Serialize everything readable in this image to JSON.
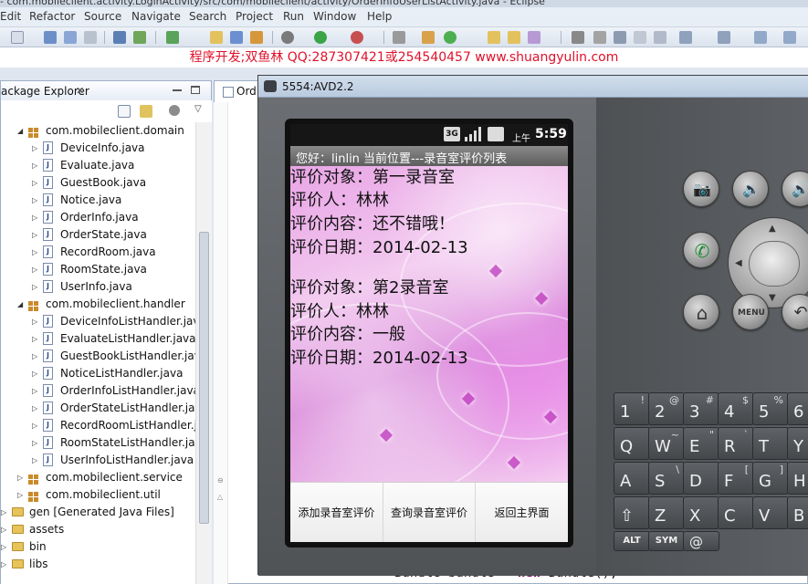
{
  "window": {
    "title": "- com.mobileclient.activity.LoginActivity/src/com/mobileclient/activity/OrderInfoUserListActivity.java - Eclipse"
  },
  "menu": [
    "Edit",
    "Refactor",
    "Source",
    "Navigate",
    "Search",
    "Project",
    "Run",
    "Window",
    "Help"
  ],
  "banner": "程序开发;双鱼林 QQ:287307421或254540457 www.shuangyulin.com",
  "package_explorer": {
    "title": "ackage Explorer",
    "close": "✕",
    "items": [
      {
        "label": "com.mobileclient.domain",
        "type": "package",
        "expanded": true
      },
      {
        "label": "DeviceInfo.java",
        "type": "file"
      },
      {
        "label": "Evaluate.java",
        "type": "file"
      },
      {
        "label": "GuestBook.java",
        "type": "file"
      },
      {
        "label": "Notice.java",
        "type": "file"
      },
      {
        "label": "OrderInfo.java",
        "type": "file"
      },
      {
        "label": "OrderState.java",
        "type": "file"
      },
      {
        "label": "RecordRoom.java",
        "type": "file"
      },
      {
        "label": "RoomState.java",
        "type": "file"
      },
      {
        "label": "UserInfo.java",
        "type": "file"
      },
      {
        "label": "com.mobileclient.handler",
        "type": "package",
        "expanded": true
      },
      {
        "label": "DeviceInfoListHandler.java",
        "type": "file"
      },
      {
        "label": "EvaluateListHandler.java",
        "type": "file"
      },
      {
        "label": "GuestBookListHandler.java",
        "type": "file"
      },
      {
        "label": "NoticeListHandler.java",
        "type": "file"
      },
      {
        "label": "OrderInfoListHandler.java",
        "type": "file"
      },
      {
        "label": "OrderStateListHandler.java",
        "type": "file"
      },
      {
        "label": "RecordRoomListHandler.ja",
        "type": "file"
      },
      {
        "label": "RoomStateListHandler.java",
        "type": "file"
      },
      {
        "label": "UserInfoListHandler.java",
        "type": "file"
      },
      {
        "label": "com.mobileclient.service",
        "type": "package",
        "expanded": false
      },
      {
        "label": "com.mobileclient.util",
        "type": "package",
        "expanded": false
      },
      {
        "label": "gen [Generated Java Files]",
        "type": "folder",
        "expanded": false
      },
      {
        "label": "assets",
        "type": "folder",
        "expanded": false
      },
      {
        "label": "bin",
        "type": "folder",
        "expanded": false
      },
      {
        "label": "libs",
        "type": "folder",
        "expanded": false
      }
    ]
  },
  "editor": {
    "tab_label": "Ord",
    "code_keyword": "new",
    "code_before": "Bundle bundle = ",
    "code_after": " Bundle();"
  },
  "emulator": {
    "title": "5554:AVD2.2",
    "status_bar": {
      "network": "3G",
      "ampm": "上午",
      "time": "5:59"
    },
    "app_title": "您好：linlin   当前位置---录音室评价列表",
    "records": [
      {
        "target": "评价对象：第一录音室",
        "person": "评价人：林林",
        "content": "评价内容：还不错哦！",
        "date": "评价日期：2014-02-13"
      },
      {
        "target": "评价对象：第2录音室",
        "person": "评价人：林林",
        "content": "评价内容：一般",
        "date": "评价日期：2014-02-13"
      }
    ],
    "buttons": [
      "添加录音室评价",
      "查询录音室评价",
      "返回主界面"
    ],
    "hardware": {
      "menu_label": "MENU"
    },
    "keyboard": [
      {
        "main": "1",
        "alt": "!"
      },
      {
        "main": "2",
        "alt": "@"
      },
      {
        "main": "3",
        "alt": "#"
      },
      {
        "main": "4",
        "alt": "$"
      },
      {
        "main": "5",
        "alt": "%"
      },
      {
        "main": "6",
        "alt": ""
      },
      {
        "main": "Q",
        "alt": ""
      },
      {
        "main": "W",
        "alt": "~"
      },
      {
        "main": "E",
        "alt": "\""
      },
      {
        "main": "R",
        "alt": "`"
      },
      {
        "main": "T",
        "alt": ""
      },
      {
        "main": "Y",
        "alt": ""
      },
      {
        "main": "A",
        "alt": ""
      },
      {
        "main": "S",
        "alt": "\\"
      },
      {
        "main": "D",
        "alt": ""
      },
      {
        "main": "F",
        "alt": "["
      },
      {
        "main": "G",
        "alt": "]"
      },
      {
        "main": "H",
        "alt": "<"
      },
      {
        "main": "⇧",
        "alt": ""
      },
      {
        "main": "Z",
        "alt": ""
      },
      {
        "main": "X",
        "alt": ""
      },
      {
        "main": "C",
        "alt": ""
      },
      {
        "main": "V",
        "alt": ""
      },
      {
        "main": "B",
        "alt": ""
      },
      {
        "small": "ALT"
      },
      {
        "small": "SYM"
      },
      {
        "main": "@",
        "alt": ""
      }
    ]
  },
  "colors": {
    "banner_text": "#e0102a",
    "keyword": "#7f0055"
  }
}
